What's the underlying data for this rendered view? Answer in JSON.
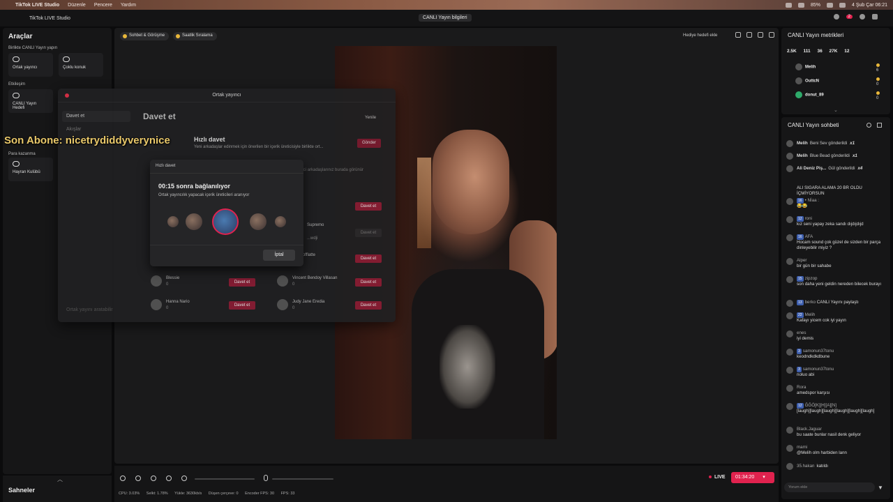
{
  "menubar": {
    "app": "TikTok LIVE Studio",
    "items": [
      "Düzenle",
      "Pencere",
      "Yardım"
    ],
    "datetime": "4 Şub Çar 06:21",
    "battery": "85%"
  },
  "titlebar": {
    "app": "TikTok LIVE Studio",
    "center": "CANLI Yayın bilgileri",
    "notif_count": "2"
  },
  "left": {
    "title": "Araçlar",
    "section1": "Birlikte CANLI Yayın yapın",
    "tile1": "Ortak yayıncı",
    "tile2": "Çoklu konuk",
    "section2": "Etkileşim",
    "tile3": "CANLI Yayın Hedefi",
    "section3": "Para kazanma",
    "tile4": "Hayran Kulübü",
    "scenes": "Sahneler"
  },
  "center": {
    "chip1": "Sohbet & Görüşme",
    "chip2": "Saatlik Sıralama",
    "hediye": "Hediye hedefi ekle"
  },
  "modal": {
    "title": "Ortak yayıncı",
    "side_active": "Davet et",
    "side_item": "Akışlar",
    "side_bottom": "Ortak yayını aratabilir",
    "heading": "Davet et",
    "refresh": "Yenile",
    "quick_title": "Hızlı davet",
    "quick_desc": "Yeni arkadaşlar edinmek için önerilen bir içerik üreticisiyle birlikte ort...",
    "send": "Gönder",
    "suggest": "...erici arkadaşlarınız burada görünür",
    "invite": "Davet et",
    "users": [
      {
        "name": "Blessie",
        "count": "0"
      },
      {
        "name": "Vincent Bendoy Villasan",
        "count": "0"
      },
      {
        "name": "Hanna Nario",
        "count": "0"
      },
      {
        "name": "Judy Jane Eredia",
        "count": "0"
      }
    ],
    "partial1": "Supremo",
    "partial2": "_biscofflatte",
    "partial3": "...wdji"
  },
  "overlay": {
    "sub_text": "Son Abone: nicetrydiddyverynice"
  },
  "popup": {
    "title": "Hızlı davet",
    "countdown": "00:15 sonra bağlanılıyor",
    "subtitle": "Ortak yayıncılık yapacak içerik üreticileri aranıyor",
    "cancel": "İptal"
  },
  "bottom": {
    "live": "LIVE",
    "timer": "01:34:20",
    "stats": {
      "cpu": "CPU: 3.03%",
      "selkt": "Selkt: 1.78%",
      "yukle": "Yükle: 3630kb/s",
      "dusen": "Düşen çerçeve: 0",
      "encoder": "Encoder FPS: 30",
      "fps": "FPS: 33"
    }
  },
  "metrics": {
    "title": "CANLI Yayın metrikleri",
    "values": [
      "2.5K",
      "111",
      "36",
      "27K",
      "12"
    ],
    "gifters": [
      {
        "name": "Melih",
        "value": "6"
      },
      {
        "name": "OuttcN",
        "value": "0"
      },
      {
        "name": "donut_89",
        "value": "0"
      }
    ]
  },
  "chat": {
    "title": "CANLI Yayın sohbeti",
    "gifts": [
      {
        "user": "Melih",
        "text": "Beni Sev gönderildi",
        "mult": "x1"
      },
      {
        "user": "Melih",
        "text": "Blue Bead gönderildi",
        "mult": "x1"
      },
      {
        "user": "Ali Deniz Piş...",
        "text": "Gül gönderildi",
        "mult": "x4"
      }
    ],
    "messages": [
      {
        "level": "",
        "user": "",
        "text": "ALI SIGARA ALAMA 20 BR OLDU İÇMİYORSUN"
      },
      {
        "level": "16",
        "user": "• Nİaa :",
        "text": "😂😂"
      },
      {
        "level": "12",
        "user": "roni",
        "text": "kız seni yapay zeka sandı dıjdıjdıjd"
      },
      {
        "level": "16",
        "user": "AFA",
        "text": "Hocam sound çok güzel de sizden bir parça dinleyebilir miyiz ?"
      },
      {
        "level": "",
        "user": "Alper",
        "text": "bir gün bir sahabe"
      },
      {
        "level": "15",
        "user": "zipzop",
        "text": "son daha yeni geldin nereden bilecek burayı"
      },
      {
        "level": "13",
        "user": "berko",
        "text": "CANLI Yayını paylaştı"
      },
      {
        "level": "22",
        "user": "Melih",
        "text": "Kafayı yicem cok iyi yayın"
      },
      {
        "level": "",
        "user": "enes",
        "text": "iyi demis"
      },
      {
        "level": "3",
        "user": "samonun37tonu",
        "text": "keodndkdkdbune"
      },
      {
        "level": "3",
        "user": "samonun37tonu",
        "text": "noluo abi"
      },
      {
        "level": "",
        "user": "Rora",
        "text": "amedspor karşısı"
      },
      {
        "level": "12",
        "user": "ĞĞÖ[K][H][A][N]",
        "text": "[laugh][laugh][laugh][laugh][laugh][laugh]"
      },
      {
        "level": "",
        "user": "Black.Jaguar",
        "text": "bu saate bunlar nasil denk geliyor"
      },
      {
        "level": "",
        "user": "mami",
        "text": "@Melih olm harbiden lann"
      }
    ],
    "joined_user": "35.hakan",
    "joined_text": "katıldı",
    "input_placeholder": "Yorum ekle"
  }
}
